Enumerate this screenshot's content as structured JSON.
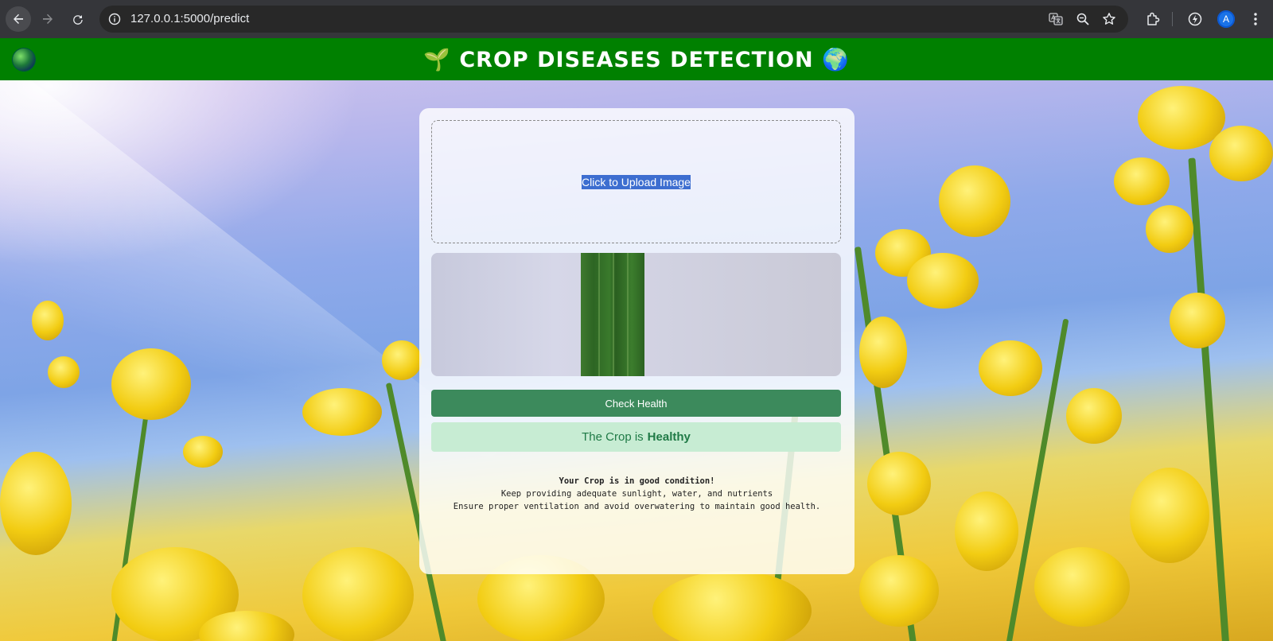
{
  "browser": {
    "url": "127.0.0.1:5000/predict",
    "avatar_letter": "A",
    "icons": [
      "back-icon",
      "forward-icon",
      "reload-icon",
      "site-info-icon",
      "translate-icon",
      "zoom-icon",
      "bookmark-star-icon",
      "extensions-icon",
      "performance-icon",
      "profile-avatar",
      "menu-kebab-icon"
    ]
  },
  "header": {
    "title": "🌱 CROP DISEASES DETECTION 🌍",
    "background": "#008000"
  },
  "card": {
    "upload_label": "Click to Upload Image",
    "check_button": "Check Health",
    "result_prefix": "The Crop is",
    "result_status": "Healthy",
    "advice_title": "Your Crop is in good condition!",
    "advice_line1": "Keep providing adequate sunlight, water, and nutrients",
    "advice_line2": "Ensure proper ventilation and avoid overwatering to maintain good health."
  },
  "colors": {
    "check_button": "#3c8a5c",
    "result_bg": "#c7ecd3",
    "result_text": "#1f7a46"
  }
}
